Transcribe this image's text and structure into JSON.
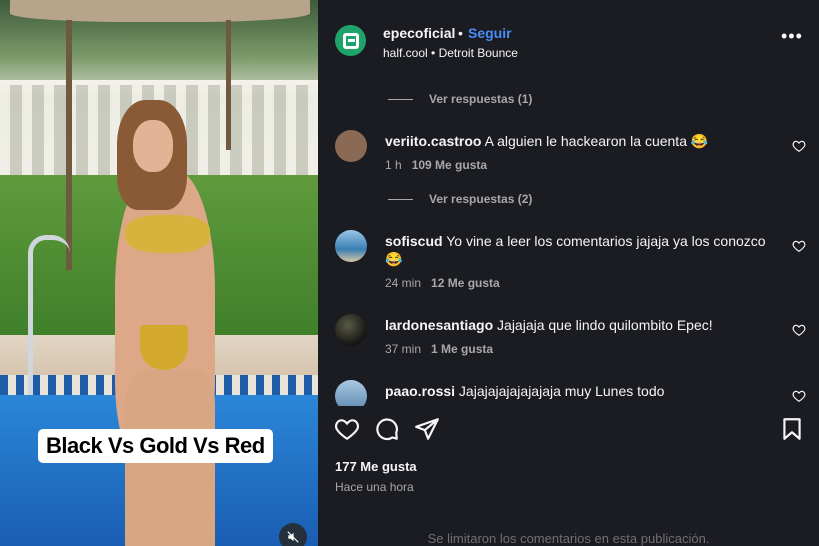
{
  "post": {
    "username": "epecoficial",
    "separator": "•",
    "follow_label": "Seguir",
    "audio": "half.cool • Detroit Bounce",
    "more_label": "•••"
  },
  "media": {
    "caption": "Black Vs Gold Vs Red",
    "mute_icon": "mute-icon"
  },
  "comments": {
    "view_replies_1": "Ver respuestas (1)",
    "view_replies_2": "Ver respuestas (2)",
    "items": [
      {
        "user": "veriito.castroo",
        "text": "A alguien le hackearon la cuenta 😂",
        "age": "1 h",
        "likes": "109 Me gusta",
        "avatar_color": "#8a6a55"
      },
      {
        "user": "sofiscud",
        "text": "Yo vine a leer los comentarios jajaja ya los conozco 😂",
        "age": "24 min",
        "likes": "12 Me gusta",
        "avatar_color": "#4a8fc0"
      },
      {
        "user": "lardonesantiago",
        "text": "Jajajaja que lindo quilombito Epec!",
        "age": "37 min",
        "likes": "1 Me gusta",
        "avatar_color": "#2a2a22"
      },
      {
        "user": "paao.rossi",
        "text": "Jajajajajajajajaja muy Lunes todo",
        "avatar_color": "#7aa3c7"
      }
    ]
  },
  "footer": {
    "likes": "177 Me gusta",
    "posted": "Hace una hora",
    "limited": "Se limitaron los comentarios en esta publicación."
  },
  "colors": {
    "panel_bg": "#1b1c21",
    "accent": "#4a8cf7",
    "brand": "#1ea46a"
  }
}
